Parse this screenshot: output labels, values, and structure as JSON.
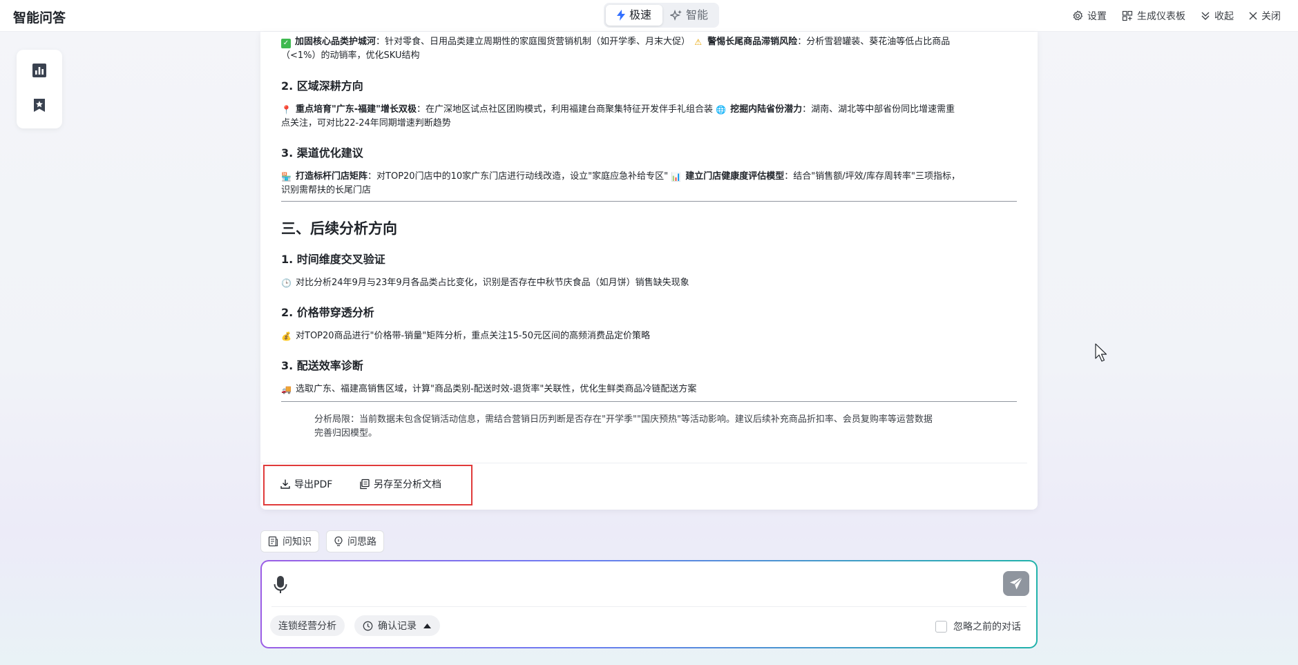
{
  "header": {
    "title": "智能问答",
    "modes": [
      "极速",
      "智能"
    ],
    "actions": {
      "settings": "设置",
      "dashboard": "生成仪表板",
      "collapse": "收起",
      "close": "关闭"
    }
  },
  "content": {
    "line1_pre": "加固核心品类护城河",
    "line1_mid": "：针对零食、日用品类建立周期性的家庭囤货营销机制（如开学季、月末大促）",
    "line1_bold2": "警惕长尾商品滞销风险",
    "line1_tail": "：分析雪碧罐装、葵花油等低占比商品",
    "line1_cont": "（<1%）的动销率，优化SKU结构",
    "h_region": "2. 区域深耕方向",
    "region_bold1": "重点培育\"广东-福建\"增长双极",
    "region_mid": "：在广深地区试点社区团购模式，利用福建台商聚集特征开发伴手礼组合装",
    "region_bold2": "挖掘内陆省份潜力",
    "region_tail": "：湖南、湖北等中部省份同比增速需重",
    "region_cont": "点关注，可对比22-24年同期增速判断趋势",
    "h_channel": "3. 渠道优化建议",
    "channel_bold1": "打造标杆门店矩阵",
    "channel_mid": "：对TOP20门店中的10家广东门店进行动线改造，设立\"家庭应急补给专区\"",
    "channel_bold2": "建立门店健康度评估模型",
    "channel_tail": "：结合\"销售额/坪效/库存周转率\"三项指标，",
    "channel_cont": "识别需帮扶的长尾门店",
    "h2_followup": "三、后续分析方向",
    "h_time": "1. 时间维度交叉验证",
    "time_text": "对比分析24年9月与23年9月各品类占比变化，识别是否存在中秋节庆食品（如月饼）销售缺失现象",
    "h_price": "2. 价格带穿透分析",
    "price_text": "对TOP20商品进行\"价格带-销量\"矩阵分析，重点关注15-50元区间的高频消费品定价策略",
    "h_delivery": "3. 配送效率诊断",
    "delivery_text": "选取广东、福建高销售区域，计算\"商品类别-配送时效-退货率\"关联性，优化生鲜类商品冷链配送方案",
    "limit_line1": "分析局限：当前数据未包含促销活动信息，需结合营销日历判断是否存在\"开学季\"\"国庆预热\"等活动影响。建议后续补充商品折扣率、会员复购率等运营数据",
    "limit_line2": "完善归因模型。"
  },
  "card_actions": {
    "export_pdf": "导出PDF",
    "save_doc": "另存至分析文档"
  },
  "chips": {
    "ask_knowledge": "问知识",
    "ask_idea": "问思路"
  },
  "input": {
    "placeholder": "",
    "scene": "连锁经营分析",
    "confirm": "确认记录",
    "ignore": "忽略之前的对话"
  },
  "colors": {
    "accent_start": "#9b5de5",
    "accent_end": "#20b2aa",
    "highlight_box": "#e03a3a"
  }
}
